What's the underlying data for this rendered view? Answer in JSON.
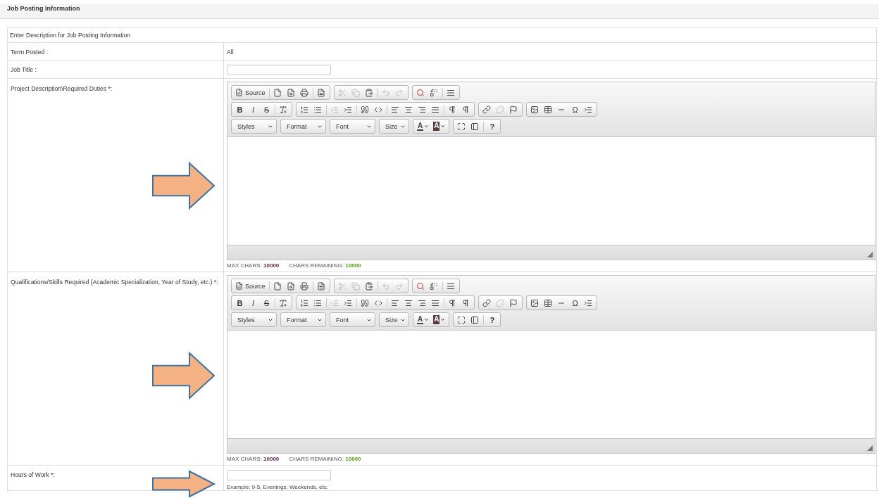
{
  "section_title": "Job Posting Information",
  "intro": "Enter Description for Job Posting Information",
  "rows": [
    {
      "kind": "text",
      "label": "Term Posted :",
      "value": "All"
    },
    {
      "kind": "input",
      "label": "Job Title :"
    },
    {
      "kind": "editor",
      "label": "Project Description\\Required Duties *:",
      "editor": {
        "toolbar": [
          [
            [
              {
                "kind": "source",
                "label": "Source"
              },
              {
                "kind": "separator"
              },
              {
                "kind": "icon",
                "disabled": false
              },
              {
                "kind": "icon",
                "disabled": false
              },
              {
                "kind": "icon",
                "disabled": false
              },
              {
                "kind": "separator"
              },
              {
                "kind": "icon",
                "disabled": false
              }
            ],
            [
              {
                "kind": "icon",
                "disabled": true
              },
              {
                "kind": "icon",
                "disabled": true
              },
              {
                "kind": "icon",
                "disabled": false
              },
              {
                "kind": "separator"
              },
              {
                "kind": "icon",
                "disabled": true
              },
              {
                "kind": "icon",
                "disabled": true
              }
            ],
            [
              {
                "kind": "icon",
                "disabled": false
              },
              {
                "kind": "icon",
                "disabled": false
              },
              {
                "kind": "separator"
              },
              {
                "kind": "icon",
                "disabled": false
              }
            ]
          ],
          [
            [
              {
                "kind": "bold",
                "label": "B"
              },
              {
                "kind": "italic",
                "label": "I"
              },
              {
                "kind": "strike",
                "label": "S"
              },
              {
                "kind": "separator"
              },
              {
                "kind": "icon",
                "disabled": false
              }
            ],
            [
              {
                "kind": "icon",
                "disabled": false
              },
              {
                "kind": "icon",
                "disabled": false
              },
              {
                "kind": "separator"
              },
              {
                "kind": "icon",
                "disabled": true
              },
              {
                "kind": "icon",
                "disabled": false
              },
              {
                "kind": "separator"
              },
              {
                "kind": "icon",
                "disabled": false
              },
              {
                "kind": "icon",
                "disabled": false
              },
              {
                "kind": "separator"
              },
              {
                "kind": "icon",
                "disabled": false
              },
              {
                "kind": "icon",
                "disabled": false
              },
              {
                "kind": "icon",
                "disabled": false
              },
              {
                "kind": "icon",
                "disabled": false
              },
              {
                "kind": "separator"
              },
              {
                "kind": "icon",
                "disabled": false
              },
              {
                "kind": "icon",
                "disabled": false
              }
            ],
            [
              {
                "kind": "icon",
                "disabled": false
              },
              {
                "kind": "icon",
                "disabled": true
              },
              {
                "kind": "icon",
                "disabled": false
              }
            ],
            [
              {
                "kind": "icon",
                "disabled": false
              },
              {
                "kind": "icon",
                "disabled": false
              },
              {
                "kind": "icon",
                "disabled": false
              },
              {
                "kind": "glyph",
                "label": "Ω"
              },
              {
                "kind": "icon",
                "disabled": false
              }
            ]
          ],
          [
            [
              {
                "kind": "dropdown",
                "label": "Styles"
              }
            ],
            [
              {
                "kind": "dropdown",
                "label": "Format"
              }
            ],
            [
              {
                "kind": "dropdown",
                "label": "Font"
              }
            ],
            [
              {
                "kind": "dropdown",
                "label": "Size"
              }
            ],
            [
              {
                "kind": "text_color",
                "label": "A"
              },
              {
                "kind": "back_color",
                "label": "A"
              }
            ],
            [
              {
                "kind": "icon",
                "disabled": false
              },
              {
                "kind": "icon",
                "disabled": false
              },
              {
                "kind": "separator"
              },
              {
                "kind": "bold",
                "label": "?"
              }
            ]
          ]
        ],
        "max_label": "MAX CHARS:",
        "max_value": "10000",
        "remaining_label": "CHARS REMAINING:",
        "remaining_value": "10000"
      }
    },
    {
      "kind": "editor",
      "label": "Qualifications/Skills Required (Academic Specialization, Year of Study, etc.) *:",
      "editor": {
        "toolbar": [
          [
            [
              {
                "kind": "source",
                "label": "Source"
              },
              {
                "kind": "separator"
              },
              {
                "kind": "icon",
                "disabled": false
              },
              {
                "kind": "icon",
                "disabled": false
              },
              {
                "kind": "icon",
                "disabled": false
              },
              {
                "kind": "separator"
              },
              {
                "kind": "icon",
                "disabled": false
              }
            ],
            [
              {
                "kind": "icon",
                "disabled": true
              },
              {
                "kind": "icon",
                "disabled": true
              },
              {
                "kind": "icon",
                "disabled": false
              },
              {
                "kind": "separator"
              },
              {
                "kind": "icon",
                "disabled": true
              },
              {
                "kind": "icon",
                "disabled": true
              }
            ],
            [
              {
                "kind": "icon",
                "disabled": false
              },
              {
                "kind": "icon",
                "disabled": false
              },
              {
                "kind": "separator"
              },
              {
                "kind": "icon",
                "disabled": false
              }
            ]
          ],
          [
            [
              {
                "kind": "bold",
                "label": "B"
              },
              {
                "kind": "italic",
                "label": "I"
              },
              {
                "kind": "strike",
                "label": "S"
              },
              {
                "kind": "separator"
              },
              {
                "kind": "icon",
                "disabled": false
              }
            ],
            [
              {
                "kind": "icon",
                "disabled": false
              },
              {
                "kind": "icon",
                "disabled": false
              },
              {
                "kind": "separator"
              },
              {
                "kind": "icon",
                "disabled": true
              },
              {
                "kind": "icon",
                "disabled": false
              },
              {
                "kind": "separator"
              },
              {
                "kind": "icon",
                "disabled": false
              },
              {
                "kind": "icon",
                "disabled": false
              },
              {
                "kind": "separator"
              },
              {
                "kind": "icon",
                "disabled": false
              },
              {
                "kind": "icon",
                "disabled": false
              },
              {
                "kind": "icon",
                "disabled": false
              },
              {
                "kind": "icon",
                "disabled": false
              },
              {
                "kind": "separator"
              },
              {
                "kind": "icon",
                "disabled": false
              },
              {
                "kind": "icon",
                "disabled": false
              }
            ],
            [
              {
                "kind": "icon",
                "disabled": false
              },
              {
                "kind": "icon",
                "disabled": true
              },
              {
                "kind": "icon",
                "disabled": false
              }
            ],
            [
              {
                "kind": "icon",
                "disabled": false
              },
              {
                "kind": "icon",
                "disabled": false
              },
              {
                "kind": "icon",
                "disabled": false
              },
              {
                "kind": "glyph",
                "label": "Ω"
              },
              {
                "kind": "icon",
                "disabled": false
              }
            ]
          ],
          [
            [
              {
                "kind": "dropdown",
                "label": "Styles"
              }
            ],
            [
              {
                "kind": "dropdown",
                "label": "Format"
              }
            ],
            [
              {
                "kind": "dropdown",
                "label": "Font"
              }
            ],
            [
              {
                "kind": "dropdown",
                "label": "Size"
              }
            ],
            [
              {
                "kind": "text_color",
                "label": "A"
              },
              {
                "kind": "back_color",
                "label": "A"
              }
            ],
            [
              {
                "kind": "icon",
                "disabled": false
              },
              {
                "kind": "icon",
                "disabled": false
              },
              {
                "kind": "separator"
              },
              {
                "kind": "bold",
                "label": "?"
              }
            ]
          ]
        ],
        "max_label": "MAX CHARS:",
        "max_value": "10000",
        "remaining_label": "CHARS REMAINING:",
        "remaining_value": "10000"
      }
    },
    {
      "kind": "input_hint",
      "label": "Hours of Work *:",
      "hint": "Example: 9-5, Evenings, Weekends, etc."
    }
  ]
}
